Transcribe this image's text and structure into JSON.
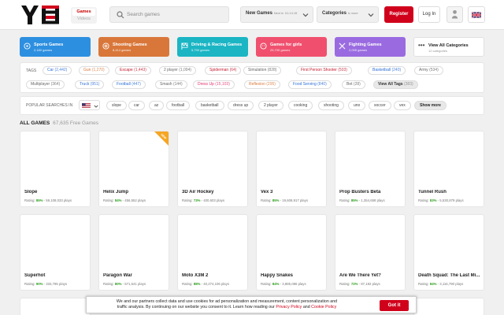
{
  "header": {
    "mode_games": "Games",
    "mode_videos": "Videos",
    "search_placeholder": "Search games",
    "new_games": "New Games",
    "new_games_next": "Next in",
    "new_games_timer": "01:14:15",
    "categories": "Categories",
    "categories_count": "& more",
    "register": "Register",
    "login": "Log In"
  },
  "categories": [
    {
      "name": "Sports Games",
      "count": "2,180 games",
      "color": "#2d8fe0"
    },
    {
      "name": "Shooting Games",
      "count": "8,414 games",
      "color": "#d9773a"
    },
    {
      "name": "Driving & Racing Games",
      "count": "5,790 games",
      "color": "#1bb5c4"
    },
    {
      "name": "Games for girls",
      "count": "25,709 games",
      "color": "#f0506e"
    },
    {
      "name": "Fighting Games",
      "count": "2,095 games",
      "color": "#9a6be0"
    },
    {
      "name": "View All Categories",
      "count": "12 categories",
      "color": "#ffffff"
    }
  ],
  "tags": {
    "label": "TAGS",
    "row1": [
      {
        "name": "Car",
        "count": "(2,442)",
        "color": "#2d6fd6"
      },
      {
        "name": "Gun",
        "count": "(1,270)",
        "color": "#d9773a"
      },
      {
        "name": "Escape",
        "count": "(1,443)",
        "color": "#c21b2e"
      },
      {
        "name": "2 player",
        "count": "(1,094)",
        "color": "#666666"
      },
      {
        "name": "Spiderman",
        "count": "(64)",
        "color": "#c21b2e"
      },
      {
        "name": "Simulation",
        "count": "(828)",
        "color": "#666666"
      },
      {
        "name": "First Person Shooter",
        "count": "(503)",
        "color": "#c21b2e"
      },
      {
        "name": "Basketball",
        "count": "(240)",
        "color": "#2d6fd6"
      },
      {
        "name": "Army",
        "count": "(534)",
        "color": "#666666"
      }
    ],
    "row2": [
      {
        "name": "Multiplayer",
        "count": "(364)",
        "color": "#666666"
      },
      {
        "name": "Truck",
        "count": "(951)",
        "color": "#2d6fd6"
      },
      {
        "name": "Football",
        "count": "(447)",
        "color": "#2d6fd6"
      },
      {
        "name": "Smash",
        "count": "(144)",
        "color": "#666666"
      },
      {
        "name": "Dress Up",
        "count": "(15,103)",
        "color": "#e0306e"
      },
      {
        "name": "Reflexion",
        "count": "(295)",
        "color": "#d9773a"
      },
      {
        "name": "Food Serving",
        "count": "(840)",
        "color": "#2d6fd6"
      },
      {
        "name": "Bet",
        "count": "(28)",
        "color": "#666666"
      }
    ],
    "view_all": "View All Tags",
    "view_all_count": "(383)"
  },
  "popular": {
    "label": "POPULAR SEARCHES IN",
    "items": [
      "slope",
      "car",
      "az",
      "football",
      "basketball",
      "dress up",
      "2 player",
      "cooking",
      "shooting",
      "uno",
      "soccer",
      "vex"
    ],
    "more": "Show more"
  },
  "all_games": {
    "title": "ALL GAMES",
    "subtitle": "67,635 Free Games"
  },
  "games": [
    {
      "name": "Slope",
      "rating": "85%",
      "plays": "59,108,033 plays"
    },
    {
      "name": "Helix Jump",
      "rating": "84%",
      "plays": "456,552 plays",
      "new": "NEW"
    },
    {
      "name": "3D Air Hockey",
      "rating": "73%",
      "plays": "400,603 plays"
    },
    {
      "name": "Vex 3",
      "rating": "85%",
      "plays": "19,608,917 plays"
    },
    {
      "name": "Prop Busters Beta",
      "rating": "85%",
      "plays": "1,354,658 plays"
    },
    {
      "name": "Tunnel Rush",
      "rating": "83%",
      "plays": "5,530,879 plays"
    },
    {
      "name": "Superhot",
      "rating": "90%",
      "plays": "333,785 plays"
    },
    {
      "name": "Paragon War",
      "rating": "80%",
      "plays": "571,541 plays"
    },
    {
      "name": "Moto X3M 2",
      "rating": "88%",
      "plays": "40,274,106 plays"
    },
    {
      "name": "Happy Snakes",
      "rating": "84%",
      "plays": "3,885,086 plays"
    },
    {
      "name": "Are We There Yet?",
      "rating": "72%",
      "plays": "87,182 plays"
    },
    {
      "name": "Death Squad: The Last Mi...",
      "rating": "84%",
      "plays": "3,116,790 plays"
    }
  ],
  "rating_prefix": "Rating:",
  "cookie": {
    "line1": "We and our partners collect data and use cookies for ad personalization and measurement, content personalization and",
    "line2": "traffic analysis. By continuing on our website you consent to it. Learn how reading our",
    "privacy": "Privacy Policy",
    "and": "and",
    "cookie_policy": "Cookie Policy",
    "ok": "Got it"
  }
}
